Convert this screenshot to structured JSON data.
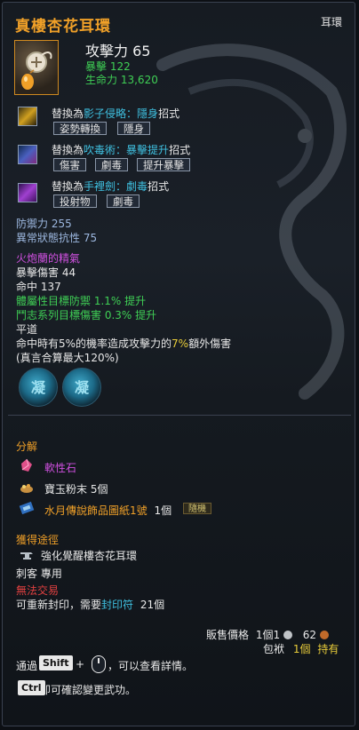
{
  "item": {
    "name": "真樓杏花耳環",
    "type": "耳環",
    "attack_label": "攻擊力",
    "attack_value": "65",
    "crit_label": "暴擊",
    "crit_value": "122",
    "hp_label": "生命力",
    "hp_value": "13,620"
  },
  "skills": [
    {
      "prefix": "替換為",
      "skill": "影子侵略",
      "sep": "：",
      "variant": "隱身",
      "suffix": "招式",
      "tags": [
        "姿勢轉換",
        "隱身"
      ]
    },
    {
      "prefix": "替換為",
      "skill": "吹毒術",
      "sep": "：",
      "variant": "暴擊提升",
      "suffix": "招式",
      "tags": [
        "傷害",
        "劇毒",
        "提升暴擊"
      ]
    },
    {
      "prefix": "替換為",
      "skill": "手裡劍",
      "sep": "：",
      "variant": "劇毒",
      "suffix": "招式",
      "tags": [
        "投射物",
        "劇毒"
      ]
    }
  ],
  "stats": {
    "defense": "防禦力 255",
    "status_resist": "異常狀態抗性 75"
  },
  "essence": {
    "title": "火炮蘭的精氣",
    "crit_damage": "暴擊傷害 44",
    "accuracy": "命中 137",
    "bonus1": "體屬性目標防禦 1.1% 提升",
    "bonus2": "鬥志系列目標傷害 0.3% 提升",
    "route": "平道",
    "effect_prefix": "命中時有5%的機率造成攻擊力的",
    "effect_pct": "7%",
    "effect_suffix": "額外傷害",
    "effect_note": "(真言合算最大120%)"
  },
  "gems": [
    "凝",
    "凝"
  ],
  "decompose": {
    "heading": "分解",
    "items": [
      {
        "name": "軟性石",
        "count": ""
      },
      {
        "name": "寶玉粉末",
        "count": "5個"
      },
      {
        "name": "水月傳說飾品圖紙1號",
        "count": "1個",
        "badge": "隨機"
      }
    ]
  },
  "acquire": {
    "heading": "獲得途徑",
    "source": "強化覺醒樓杏花耳環",
    "class_req": "刺客  專用",
    "untradeable": "無法交易",
    "reseal_prefix": "可重新封印，需要",
    "reseal_item": "封印符",
    "reseal_count": "21個"
  },
  "price": {
    "label": "販售價格",
    "count": "1個",
    "silver": "1",
    "copper": "62",
    "bag_label": "包袱",
    "bag_count": "1個",
    "owned": "持有"
  },
  "hints": {
    "h1_prefix": "通過",
    "shift_key": "Shift",
    "plus": "+",
    "h1_suffix": "，可以查看詳情。",
    "ctrl_key": "Ctrl",
    "h2_suffix": "即可確認變更武功。"
  }
}
